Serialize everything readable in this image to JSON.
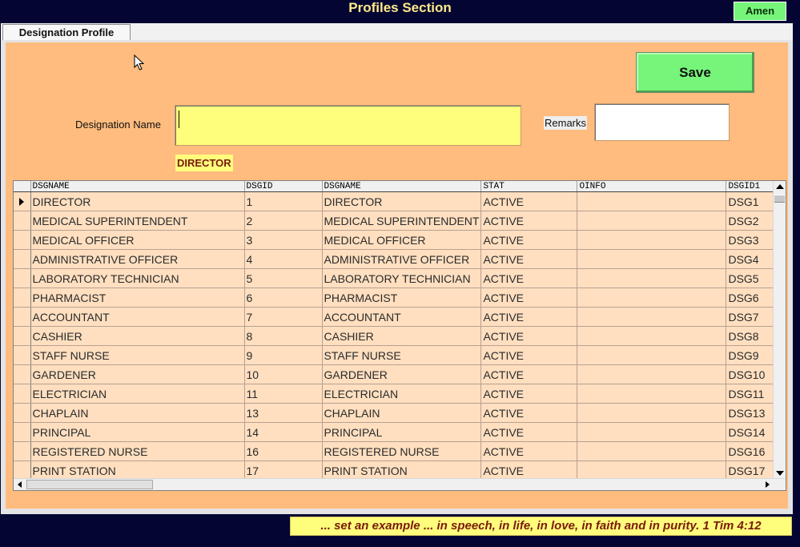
{
  "window": {
    "title": "Profiles Section",
    "user_button": "Amen"
  },
  "tabs": [
    {
      "label": "Designation Profile",
      "active": true
    }
  ],
  "form": {
    "save_label": "Save",
    "designation_label": "Designation Name",
    "designation_value": "",
    "remarks_label": "Remarks",
    "remarks_value": "",
    "selected_designation": "DIRECTOR"
  },
  "grid": {
    "columns": [
      "DSGNAME",
      "DSGID",
      "DSGNAME",
      "STAT",
      "OINFO",
      "DSGID1"
    ],
    "rows": [
      [
        "DIRECTOR",
        "1",
        "DIRECTOR",
        "ACTIVE",
        "",
        "DSG1"
      ],
      [
        "MEDICAL SUPERINTENDENT",
        "2",
        "MEDICAL SUPERINTENDENT",
        "ACTIVE",
        "",
        "DSG2"
      ],
      [
        "MEDICAL OFFICER",
        "3",
        "MEDICAL OFFICER",
        "ACTIVE",
        "",
        "DSG3"
      ],
      [
        "ADMINISTRATIVE OFFICER",
        "4",
        "ADMINISTRATIVE OFFICER",
        "ACTIVE",
        "",
        "DSG4"
      ],
      [
        "LABORATORY TECHNICIAN",
        "5",
        "LABORATORY TECHNICIAN",
        "ACTIVE",
        "",
        "DSG5"
      ],
      [
        "PHARMACIST",
        "6",
        "PHARMACIST",
        "ACTIVE",
        "",
        "DSG6"
      ],
      [
        "ACCOUNTANT",
        "7",
        "ACCOUNTANT",
        "ACTIVE",
        "",
        "DSG7"
      ],
      [
        "CASHIER",
        "8",
        "CASHIER",
        "ACTIVE",
        "",
        "DSG8"
      ],
      [
        "STAFF NURSE",
        "9",
        "STAFF NURSE",
        "ACTIVE",
        "",
        "DSG9"
      ],
      [
        "GARDENER",
        "10",
        "GARDENER",
        "ACTIVE",
        "",
        "DSG10"
      ],
      [
        "ELECTRICIAN",
        "11",
        "ELECTRICIAN",
        "ACTIVE",
        "",
        "DSG11"
      ],
      [
        "CHAPLAIN",
        "13",
        "CHAPLAIN",
        "ACTIVE",
        "",
        "DSG13"
      ],
      [
        "PRINCIPAL",
        "14",
        "PRINCIPAL",
        "ACTIVE",
        "",
        "DSG14"
      ],
      [
        "REGISTERED NURSE",
        "16",
        "REGISTERED NURSE",
        "ACTIVE",
        "",
        "DSG16"
      ],
      [
        "PRINT STATION",
        "17",
        "PRINT STATION",
        "ACTIVE",
        "",
        "DSG17"
      ]
    ],
    "selected_row": 0
  },
  "footer": {
    "verse": "... set an example ... in speech, in life, in love, in faith and in purity.  1 Tim 4:12"
  },
  "colors": {
    "background": "#050533",
    "panel": "#ffbc7e",
    "input_highlight": "#fffd7c",
    "button_green": "#76f57a",
    "grid_row": "#ffdfc0",
    "title_text": "#ffe98a"
  }
}
